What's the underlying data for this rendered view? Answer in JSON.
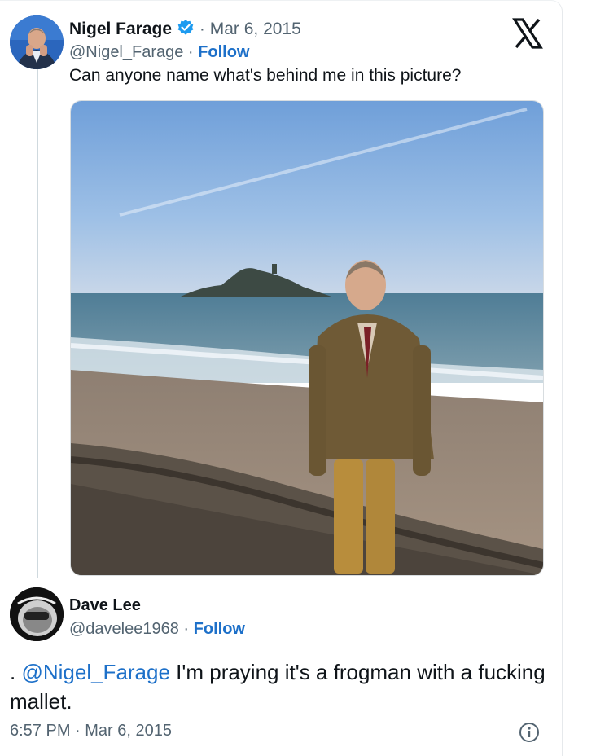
{
  "tweet": {
    "author_name": "Nigel Farage",
    "date": "Mar 6, 2015",
    "handle": "@Nigel_Farage",
    "follow_label": "Follow",
    "text": "Can anyone name what's behind me in this picture?",
    "verified": true
  },
  "reply": {
    "author_name": "Dave Lee",
    "handle": "@davelee1968",
    "follow_label": "Follow",
    "prefix": ". ",
    "mention": "@Nigel_Farage",
    "text": " I'm praying it's a frogman with a fucking mallet.",
    "timestamp": "6:57 PM · Mar 6, 2015"
  },
  "separators": {
    "dot": " · "
  },
  "colors": {
    "link": "#1d70c9",
    "verified": "#1d9bf0",
    "muted": "#536471"
  },
  "icons": {
    "platform": "x-logo-icon",
    "info": "info-icon",
    "verified": "verified-badge-icon"
  }
}
